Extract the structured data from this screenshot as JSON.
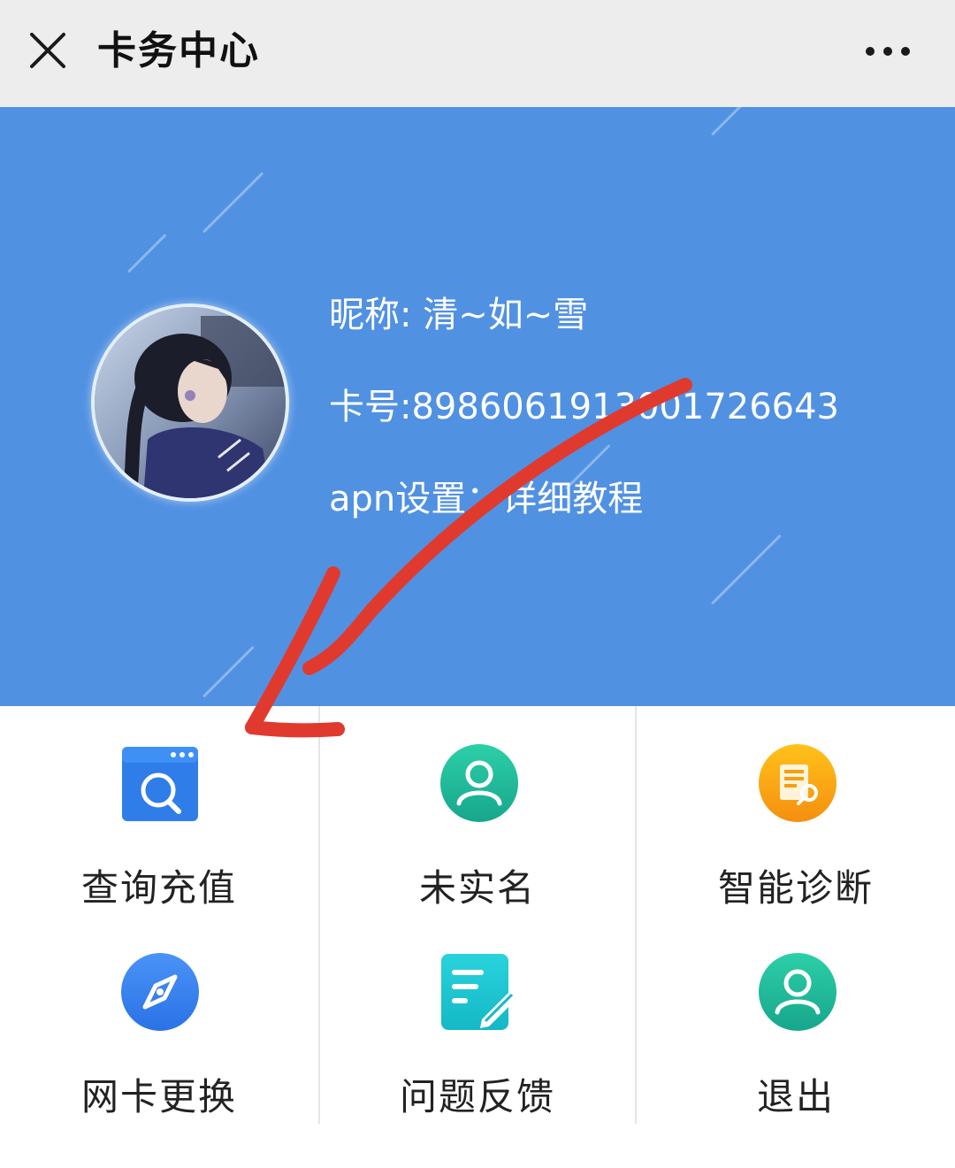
{
  "topbar": {
    "title": "卡务中心",
    "close_icon": "close-icon",
    "more_icon": "more-dots-icon"
  },
  "profile": {
    "nickname": "昵称: 清~如~雪",
    "card_number": "卡号:89860619130017266​43",
    "apn": "apn设置：详细教程"
  },
  "menu": {
    "items": [
      {
        "label": "查询充值",
        "icon": "search-browser-icon"
      },
      {
        "label": "未实名",
        "icon": "user-icon"
      },
      {
        "label": "智能诊断",
        "icon": "diagnosis-document-icon"
      },
      {
        "label": "网卡更换",
        "icon": "compass-icon"
      },
      {
        "label": "问题反馈",
        "icon": "edit-document-icon"
      },
      {
        "label": "退出",
        "icon": "user-icon"
      }
    ]
  },
  "colors": {
    "header_blue": "#5191e2",
    "topbar_gray": "#ededed",
    "annotation_red": "#e03a2f",
    "teal": "#1fb89a",
    "orange": "#f7a71a",
    "blue_icon": "#3d85f0"
  }
}
